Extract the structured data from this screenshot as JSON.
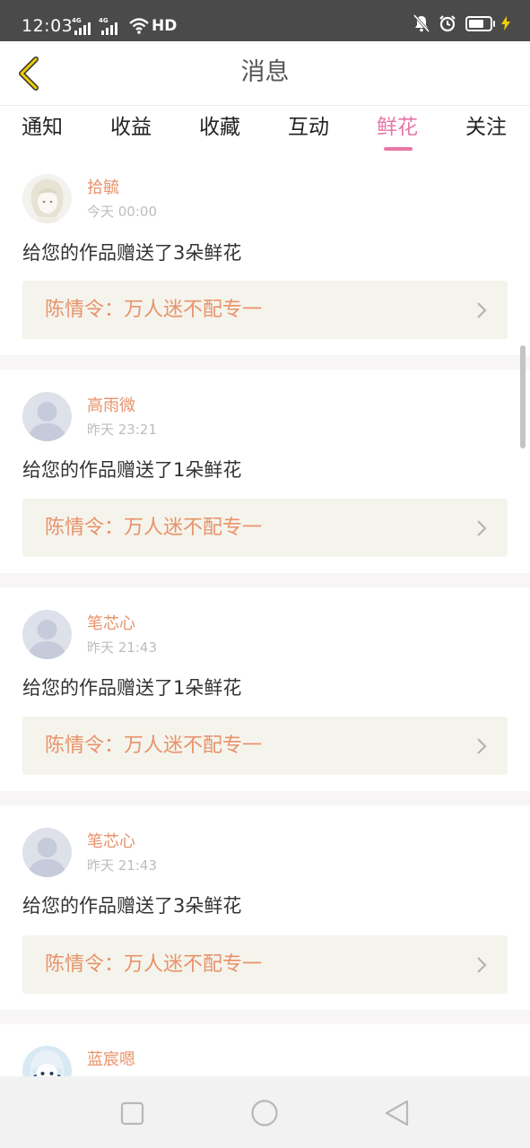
{
  "status_bar": {
    "time": "12:03",
    "signal_1_tag": "4G",
    "signal_2_tag": "4G",
    "hd_label": "HD",
    "icons": [
      "signal-icon",
      "signal-icon",
      "wifi-icon",
      "mute-bell-icon",
      "alarm-icon",
      "battery-icon",
      "charging-icon"
    ]
  },
  "header": {
    "title": "消息",
    "back_icon": "chevron-left-icon",
    "accent_color": "#f2cf00"
  },
  "tabs": {
    "items": [
      "通知",
      "收益",
      "收藏",
      "互动",
      "鲜花",
      "关注"
    ],
    "active": "鲜花",
    "active_color": "#e877a6"
  },
  "feed": {
    "items": [
      {
        "user": "拾毓",
        "time": "今天 00:00",
        "message": "给您的作品赠送了3朵鲜花",
        "work": "陈情令：万人迷不配专一",
        "avatar": "illustrated-avatar"
      },
      {
        "user": "高雨微",
        "time": "昨天 23:21",
        "message": "给您的作品赠送了1朵鲜花",
        "work": "陈情令：万人迷不配专一",
        "avatar": "default-avatar"
      },
      {
        "user": "笔芯心",
        "time": "昨天 21:43",
        "message": "给您的作品赠送了1朵鲜花",
        "work": "陈情令：万人迷不配专一",
        "avatar": "default-avatar"
      },
      {
        "user": "笔芯心",
        "time": "昨天 21:43",
        "message": "给您的作品赠送了3朵鲜花",
        "work": "陈情令：万人迷不配专一",
        "avatar": "default-avatar"
      },
      {
        "user": "蓝宸嗯",
        "avatar": "illustrated-avatar"
      }
    ],
    "name_color": "#e8926a",
    "work_bg": "#f5f4ec"
  },
  "nav_bar": {
    "icons": [
      "recent-apps-icon",
      "home-icon",
      "back-icon"
    ]
  }
}
